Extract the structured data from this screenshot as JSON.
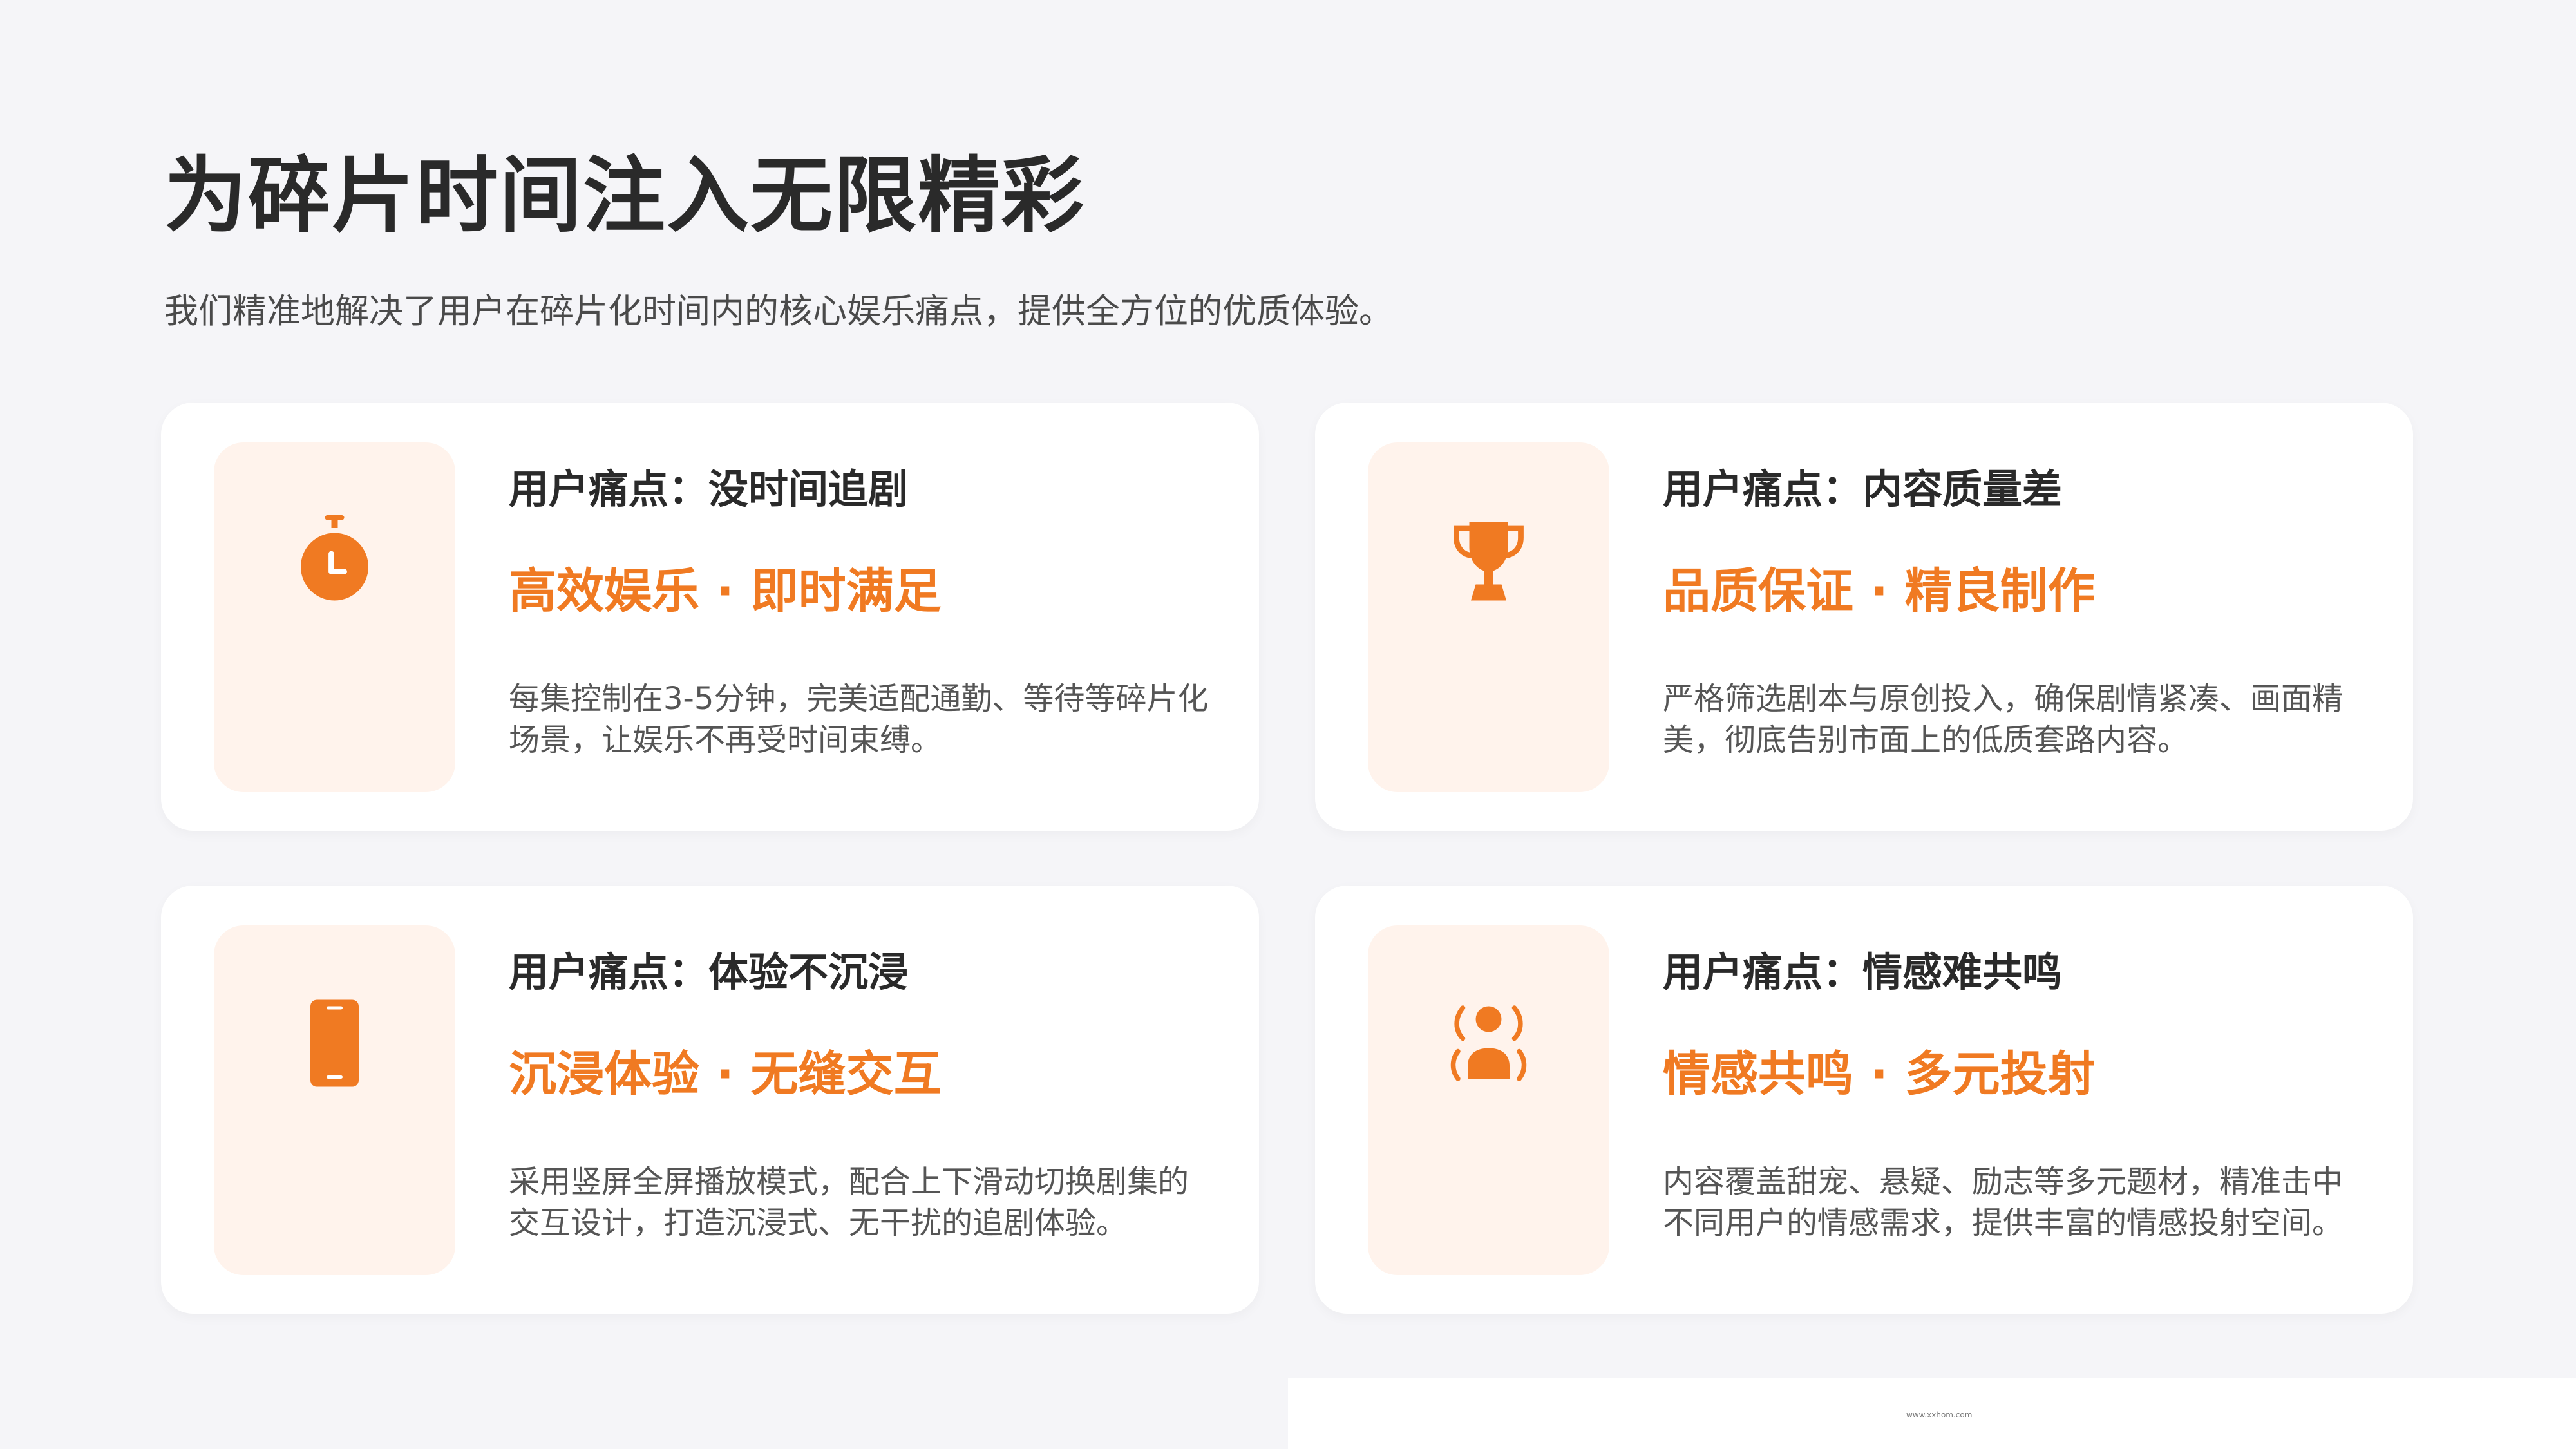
{
  "header": {
    "title": "为碎片时间注入无限精彩",
    "subtitle": "我们精准地解决了用户在碎片化时间内的核心娱乐痛点，提供全方位的优质体验。"
  },
  "cards": [
    {
      "icon": "stopwatch-icon",
      "label": "用户痛点：没时间追剧",
      "headline": "高效娱乐 · 即时满足",
      "description": "每集控制在3-5分钟，完美适配通勤、等待等碎片化场景，让娱乐不再受时间束缚。"
    },
    {
      "icon": "trophy-icon",
      "label": "用户痛点：内容质量差",
      "headline": "品质保证 · 精良制作",
      "description": "严格筛选剧本与原创投入，确保剧情紧凑、画面精美，彻底告别市面上的低质套路内容。"
    },
    {
      "icon": "smartphone-icon",
      "label": "用户痛点：体验不沉浸",
      "headline": "沉浸体验 · 无缝交互",
      "description": "采用竖屏全屏播放模式，配合上下滑动切换剧集的交互设计，打造沉浸式、无干扰的追剧体验。"
    },
    {
      "icon": "person-broadcast-icon",
      "label": "用户痛点：情感难共鸣",
      "headline": "情感共鸣 · 多元投射",
      "description": "内容覆盖甜宠、悬疑、励志等多元题材，精准击中不同用户的情感需求，提供丰富的情感投射空间。"
    }
  ],
  "footer": {
    "url": "www.xxhom.com"
  },
  "colors": {
    "accent": "#f07a22",
    "icon_bg": "#fff3ec",
    "page_bg": "#f5f5f8"
  }
}
